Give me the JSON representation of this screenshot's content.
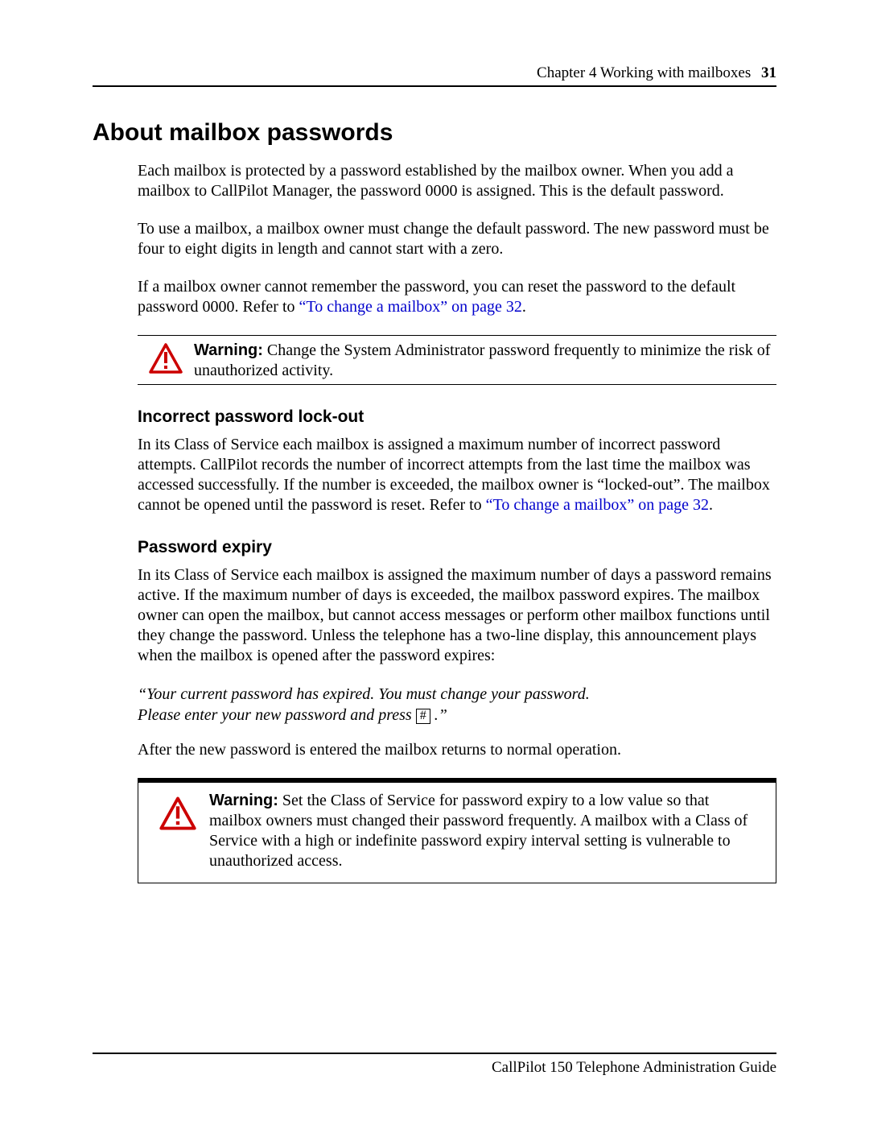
{
  "header": {
    "chapter": "Chapter 4  Working with mailboxes",
    "page_number": "31"
  },
  "title": "About mailbox passwords",
  "intro_p1": "Each mailbox is protected by a password established by the mailbox owner. When you add a mailbox to CallPilot Manager, the password 0000 is assigned. This is the default password.",
  "intro_p2": "To use a mailbox, a mailbox owner must change the default password. The new password must be four to eight digits in length and cannot start with a zero.",
  "intro_p3_pre": "If a mailbox owner cannot remember the password, you can reset the password to the default password 0000. Refer to ",
  "intro_p3_link": "“To change a mailbox” on page 32",
  "intro_p3_post": ".",
  "warning1": {
    "label": "Warning:",
    "text": " Change the System Administrator password frequently to minimize the risk of unauthorized activity."
  },
  "section_lockout": {
    "heading": "Incorrect password lock-out",
    "body_pre": "In its Class of Service each mailbox is assigned a maximum number of incorrect password attempts. CallPilot records the number of incorrect attempts from the last time the mailbox was accessed successfully. If the number is exceeded, the mailbox owner is “locked-out”. The mailbox cannot be opened until the password is reset. Refer to ",
    "body_link": "“To change a mailbox” on page 32",
    "body_post": "."
  },
  "section_expiry": {
    "heading": "Password expiry",
    "body": "In its Class of Service each mailbox is assigned the maximum number of days a password remains active. If the maximum number of days is exceeded, the mailbox password expires. The mailbox owner can open the mailbox, but cannot access messages or perform other mailbox functions until they change the password. Unless the telephone has a two-line display, this announcement plays when the mailbox is opened after the password expires:",
    "quote_line1": "“Your current password has expired. You must change your password.",
    "quote_line2_pre": "Please enter your new password and press ",
    "quote_key": "#",
    "quote_line2_post": " .”",
    "after": "After the new password is entered the mailbox returns to normal operation."
  },
  "warning2": {
    "label": "Warning:",
    "text": " Set the Class of Service for password expiry to a low value so that mailbox owners must changed their password frequently. A mailbox with a Class of Service with a high or indefinite password expiry interval setting is vulnerable to unauthorized access."
  },
  "footer": "CallPilot 150 Telephone Administration Guide"
}
